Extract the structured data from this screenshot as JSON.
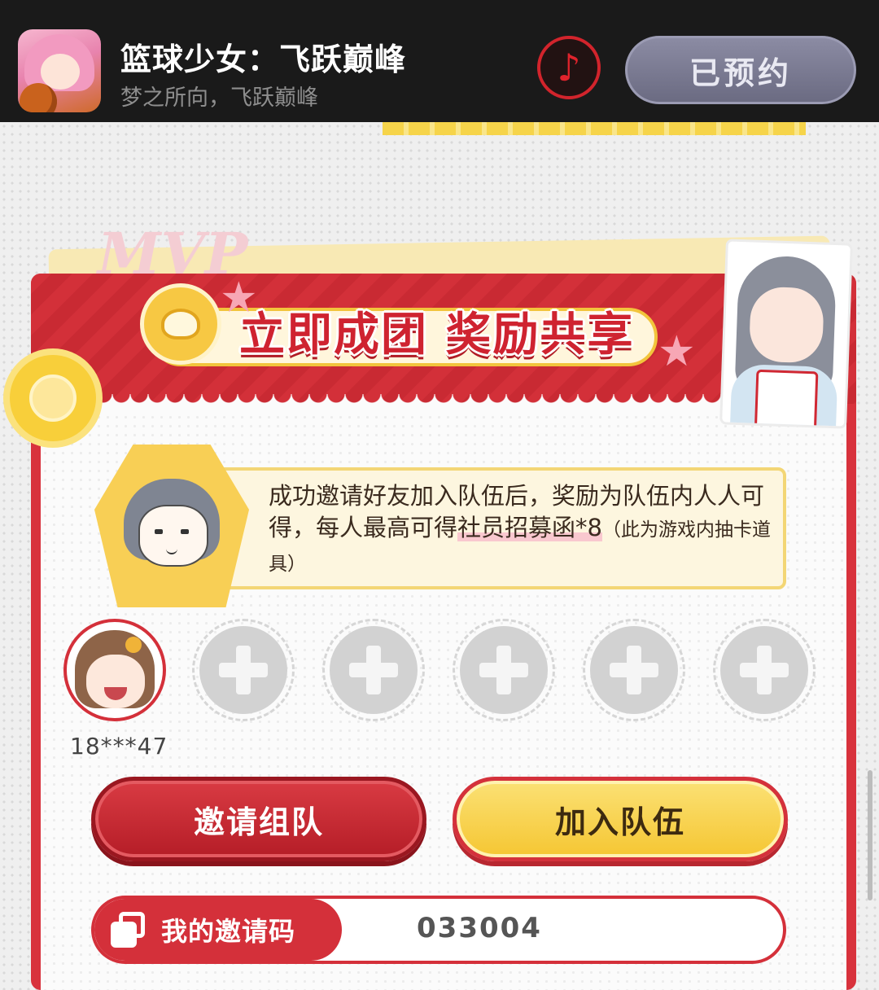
{
  "header": {
    "app_title": "篮球少女：飞跃巅峰",
    "app_subtitle": "梦之所向，飞跃巅峰",
    "reserve_label": "已预约",
    "music_icon": "music-note-icon"
  },
  "banner": {
    "title": "立即成团 奖励共享"
  },
  "info": {
    "line_before": "成功邀请好友加入队伍后，奖励为队伍内人人可得，每人最高可得",
    "highlight": "社员招募函*8",
    "note": "（此为游戏内抽卡道具）"
  },
  "team": {
    "members": [
      {
        "name": "18***47"
      }
    ],
    "empty_slots": 5
  },
  "actions": {
    "invite_label": "邀请组队",
    "join_label": "加入队伍"
  },
  "invite_code": {
    "label": "我的邀请码",
    "value": "033004"
  },
  "colors": {
    "brand_red": "#d4303a",
    "accent_yellow": "#f5c632",
    "topbar": "#1a1a1a"
  }
}
